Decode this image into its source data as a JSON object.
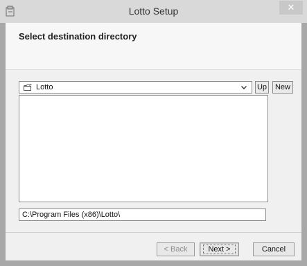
{
  "window": {
    "title": "Lotto Setup",
    "close_glyph": "✕",
    "icon": "installer-icon"
  },
  "page": {
    "heading": "Select destination directory"
  },
  "folder_picker": {
    "selected": "Lotto",
    "icon": "folder-icon",
    "up_label": "Up",
    "new_label": "New"
  },
  "path": {
    "value": "C:\\Program Files (x86)\\Lotto\\"
  },
  "buttons": {
    "back": "< Back",
    "next": "Next >",
    "cancel": "Cancel"
  },
  "colors": {
    "title_bar": "#d9d9d9",
    "window_bg": "#f0f0f0",
    "disabled_text": "#8c8c8c"
  }
}
